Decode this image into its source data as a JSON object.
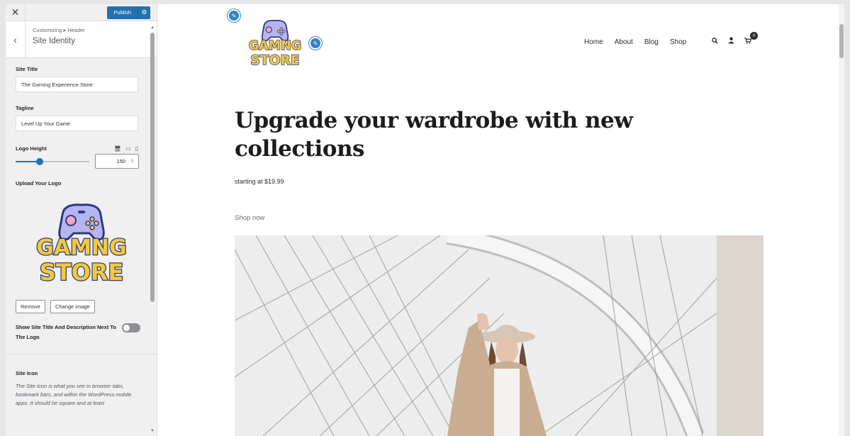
{
  "customizer": {
    "close_icon": "close-icon",
    "publish_label": "Publish",
    "publish_settings_icon": "gear-icon",
    "back_icon": "chevron-left-icon",
    "breadcrumb": "Customizing ▸ Header",
    "section_title": "Site Identity",
    "site_title_label": "Site Title",
    "site_title_value": "The Gaming Experience Store",
    "tagline_label": "Tagline",
    "tagline_value": "Level Up Your Game",
    "logo_height_label": "Logo Height",
    "logo_height_value": "150",
    "logo_height_slider_fraction": 0.33,
    "upload_logo_label": "Upload Your Logo",
    "remove_label": "Remove",
    "change_image_label": "Change image",
    "show_title_toggle_label": "Show Site Title And Description Next To The Logo",
    "show_title_toggle_on": false,
    "site_icon_label": "Site Icon",
    "site_icon_description": "The Site Icon is what you see in browser tabs, bookmark bars, and within the WordPress mobile apps. It should be square and at least"
  },
  "logo": {
    "line1": "GAMNG",
    "line2": "STORE"
  },
  "site": {
    "nav": [
      "Home",
      "About",
      "Blog",
      "Shop"
    ],
    "cart_count": "0",
    "hero_title": "Upgrade your wardrobe with new collections",
    "hero_subtitle": "starting at $19.99",
    "hero_link": "Shop now"
  },
  "colors": {
    "accent": "#2271b1",
    "edit_shortcut": "#3582c4",
    "logo_yellow": "#f6c93b",
    "logo_purple": "#b6b4f2",
    "logo_outline": "#2f3a7a"
  }
}
